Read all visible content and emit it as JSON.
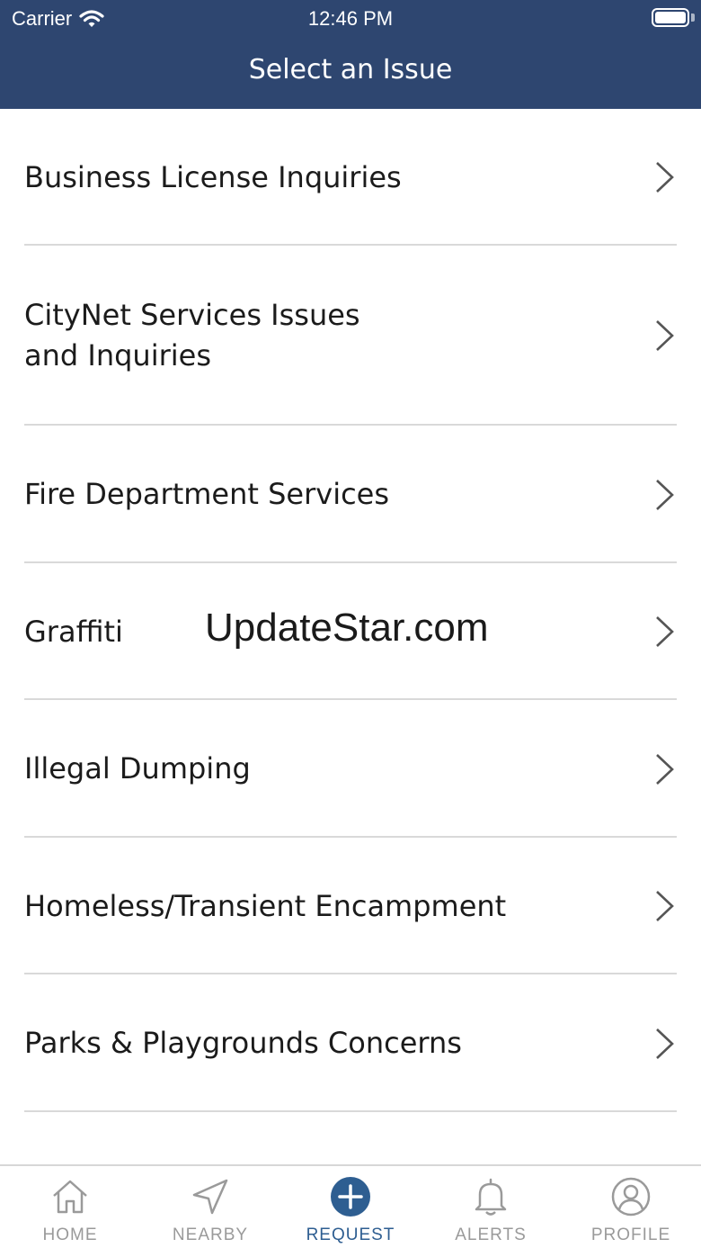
{
  "status_bar": {
    "carrier": "Carrier",
    "time": "12:46 PM"
  },
  "header": {
    "title": "Select an Issue"
  },
  "issues": [
    {
      "label": "Business License Inquiries"
    },
    {
      "label": "CityNet Services Issues\nand Inquiries"
    },
    {
      "label": "Fire Department Services"
    },
    {
      "label": "Graffiti"
    },
    {
      "label": "Illegal Dumping"
    },
    {
      "label": "Homeless/Transient Encampment"
    },
    {
      "label": "Parks & Playgrounds Concerns"
    }
  ],
  "watermark": "UpdateStar.com",
  "tabbar": {
    "home": "HOME",
    "nearby": "NEARBY",
    "request": "REQUEST",
    "alerts": "ALERTS",
    "profile": "PROFILE",
    "active_tab": "request"
  },
  "colors": {
    "header_bg": "#2e4670",
    "accent": "#2e5e91",
    "inactive": "#9a9a9a"
  },
  "icons": [
    "wifi-icon",
    "battery-icon",
    "chevron-right-icon",
    "home-icon",
    "nearby-icon",
    "request-plus-icon",
    "alerts-bell-icon",
    "profile-icon"
  ]
}
